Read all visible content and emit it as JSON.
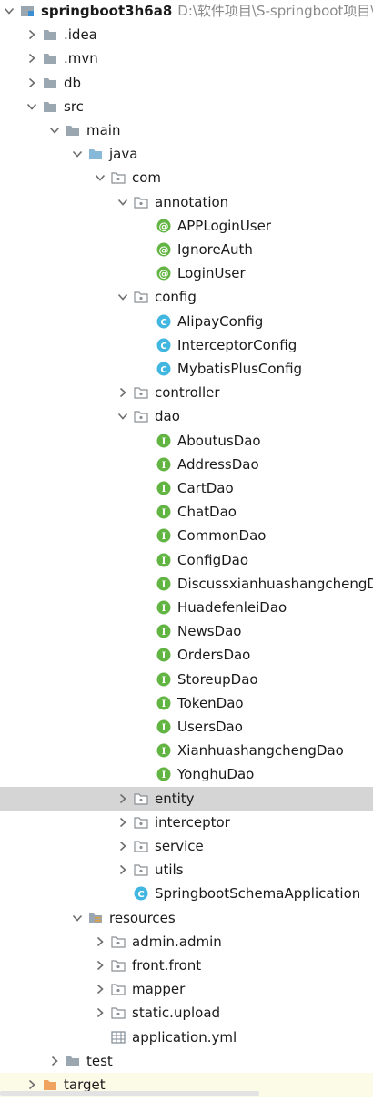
{
  "project_tree": {
    "rows": [
      {
        "id": "root",
        "label": "springboot3h6a8",
        "path": "D:\\软件项目\\S-springboot项目\\S",
        "depth": 0,
        "expanded": true,
        "icon": "module",
        "bold": true
      },
      {
        "id": "idea",
        "label": ".idea",
        "depth": 1,
        "expanded": false,
        "icon": "folder-gray"
      },
      {
        "id": "mvn",
        "label": ".mvn",
        "depth": 1,
        "expanded": false,
        "icon": "folder-gray"
      },
      {
        "id": "db",
        "label": "db",
        "depth": 1,
        "expanded": false,
        "icon": "folder-gray"
      },
      {
        "id": "src",
        "label": "src",
        "depth": 1,
        "expanded": true,
        "icon": "folder-gray"
      },
      {
        "id": "main",
        "label": "main",
        "depth": 2,
        "expanded": true,
        "icon": "folder-gray"
      },
      {
        "id": "java",
        "label": "java",
        "depth": 3,
        "expanded": true,
        "icon": "folder-blue"
      },
      {
        "id": "com",
        "label": "com",
        "depth": 4,
        "expanded": true,
        "icon": "package"
      },
      {
        "id": "annotation",
        "label": "annotation",
        "depth": 5,
        "expanded": true,
        "icon": "package"
      },
      {
        "id": "apploginuser",
        "label": "APPLoginUser",
        "depth": 6,
        "icon": "annotation"
      },
      {
        "id": "ignoreauth",
        "label": "IgnoreAuth",
        "depth": 6,
        "icon": "annotation"
      },
      {
        "id": "loginuser",
        "label": "LoginUser",
        "depth": 6,
        "icon": "annotation"
      },
      {
        "id": "config",
        "label": "config",
        "depth": 5,
        "expanded": true,
        "icon": "package"
      },
      {
        "id": "alipayconfig",
        "label": "AlipayConfig",
        "depth": 6,
        "icon": "class"
      },
      {
        "id": "interceptorconfig",
        "label": "InterceptorConfig",
        "depth": 6,
        "icon": "class"
      },
      {
        "id": "mybatisplusconfig",
        "label": "MybatisPlusConfig",
        "depth": 6,
        "icon": "class"
      },
      {
        "id": "controller",
        "label": "controller",
        "depth": 5,
        "expanded": false,
        "icon": "package"
      },
      {
        "id": "dao",
        "label": "dao",
        "depth": 5,
        "expanded": true,
        "icon": "package"
      },
      {
        "id": "aboutusdao",
        "label": "AboutusDao",
        "depth": 6,
        "icon": "interface"
      },
      {
        "id": "addressdao",
        "label": "AddressDao",
        "depth": 6,
        "icon": "interface"
      },
      {
        "id": "cartdao",
        "label": "CartDao",
        "depth": 6,
        "icon": "interface"
      },
      {
        "id": "chatdao",
        "label": "ChatDao",
        "depth": 6,
        "icon": "interface"
      },
      {
        "id": "commondao",
        "label": "CommonDao",
        "depth": 6,
        "icon": "interface"
      },
      {
        "id": "configdao",
        "label": "ConfigDao",
        "depth": 6,
        "icon": "interface"
      },
      {
        "id": "discussdao",
        "label": "DiscussxianhuashangchengDa",
        "depth": 6,
        "icon": "interface"
      },
      {
        "id": "huadefenleidao",
        "label": "HuadefenleiDao",
        "depth": 6,
        "icon": "interface"
      },
      {
        "id": "newsdao",
        "label": "NewsDao",
        "depth": 6,
        "icon": "interface"
      },
      {
        "id": "ordersdao",
        "label": "OrdersDao",
        "depth": 6,
        "icon": "interface"
      },
      {
        "id": "storeupdao",
        "label": "StoreupDao",
        "depth": 6,
        "icon": "interface"
      },
      {
        "id": "tokendao",
        "label": "TokenDao",
        "depth": 6,
        "icon": "interface"
      },
      {
        "id": "usersdao",
        "label": "UsersDao",
        "depth": 6,
        "icon": "interface"
      },
      {
        "id": "xianhuadao",
        "label": "XianhuashangchengDao",
        "depth": 6,
        "icon": "interface"
      },
      {
        "id": "yonghudao",
        "label": "YonghuDao",
        "depth": 6,
        "icon": "interface"
      },
      {
        "id": "entity",
        "label": "entity",
        "depth": 5,
        "expanded": false,
        "icon": "package",
        "selected": true
      },
      {
        "id": "interceptor",
        "label": "interceptor",
        "depth": 5,
        "expanded": false,
        "icon": "package"
      },
      {
        "id": "service",
        "label": "service",
        "depth": 5,
        "expanded": false,
        "icon": "package"
      },
      {
        "id": "utils",
        "label": "utils",
        "depth": 5,
        "expanded": false,
        "icon": "package"
      },
      {
        "id": "springbootapp",
        "label": "SpringbootSchemaApplication",
        "depth": 5,
        "icon": "class"
      },
      {
        "id": "resources",
        "label": "resources",
        "depth": 3,
        "expanded": true,
        "icon": "folder-resources"
      },
      {
        "id": "adminadmin",
        "label": "admin.admin",
        "depth": 4,
        "expanded": false,
        "icon": "package"
      },
      {
        "id": "frontfront",
        "label": "front.front",
        "depth": 4,
        "expanded": false,
        "icon": "package"
      },
      {
        "id": "mapper",
        "label": "mapper",
        "depth": 4,
        "expanded": false,
        "icon": "package"
      },
      {
        "id": "staticupload",
        "label": "static.upload",
        "depth": 4,
        "expanded": false,
        "icon": "package"
      },
      {
        "id": "applicationyml",
        "label": "application.yml",
        "depth": 4,
        "icon": "yml"
      },
      {
        "id": "test",
        "label": "test",
        "depth": 2,
        "expanded": false,
        "icon": "folder-gray"
      },
      {
        "id": "target",
        "label": "target",
        "depth": 1,
        "expanded": false,
        "icon": "folder-orange",
        "highlighted": true
      }
    ]
  },
  "colors": {
    "chevron": "#6e6e6e",
    "folder_gray": "#9aa7b0",
    "folder_blue": "#87b8d8",
    "folder_orange": "#f0a35e",
    "package_border": "#8a8f95",
    "annotation_green": "#62b543",
    "class_blue": "#40b6e0",
    "interface_green": "#62b543",
    "selected_row": "#d5d5d5",
    "highlight_row": "#fcfbe7"
  }
}
